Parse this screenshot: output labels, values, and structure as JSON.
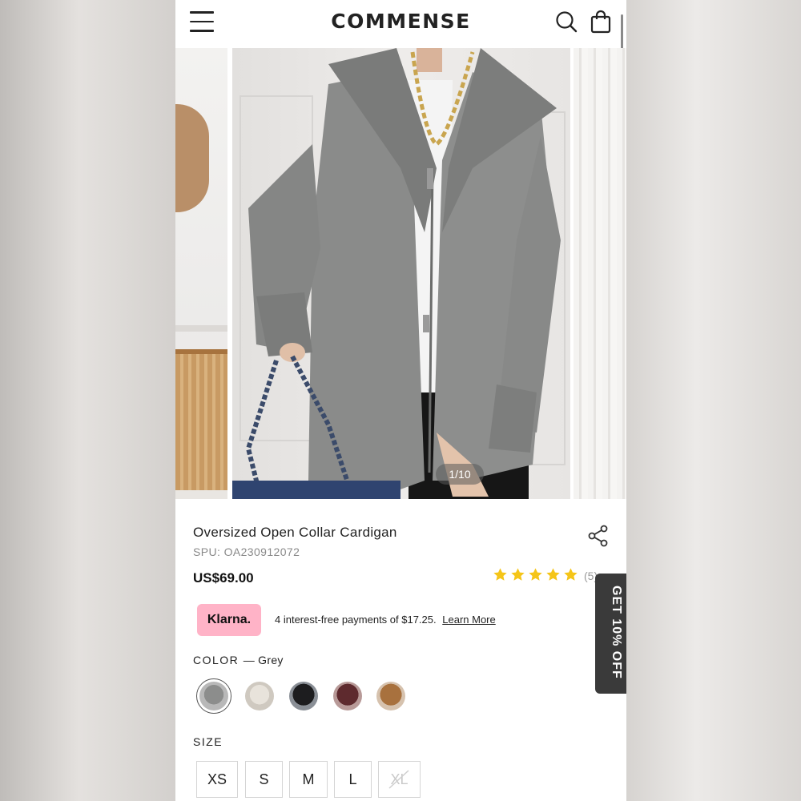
{
  "header": {
    "logo": "COMMENSE"
  },
  "gallery": {
    "counter": "1/10"
  },
  "product": {
    "title": "Oversized Open Collar Cardigan",
    "spu": "SPU: OA230912072",
    "price": "US$69.00",
    "rating": 5,
    "reviews": "(5)"
  },
  "klarna": {
    "badge": "Klarna.",
    "text": "4 interest-free payments of $17.25.",
    "link": "Learn More"
  },
  "color": {
    "label": "COLOR",
    "value": "— Grey",
    "swatches": [
      "grey",
      "cream",
      "black",
      "burgundy",
      "camel"
    ]
  },
  "size": {
    "label": "SIZE",
    "options": [
      "XS",
      "S",
      "M",
      "L",
      "XL"
    ]
  },
  "promo": {
    "text": "GET 10% OFF"
  },
  "colors": {
    "star": "#f5c518",
    "klarna_pink": "#ffb3c7",
    "promo_bg": "#3a3a3a"
  }
}
